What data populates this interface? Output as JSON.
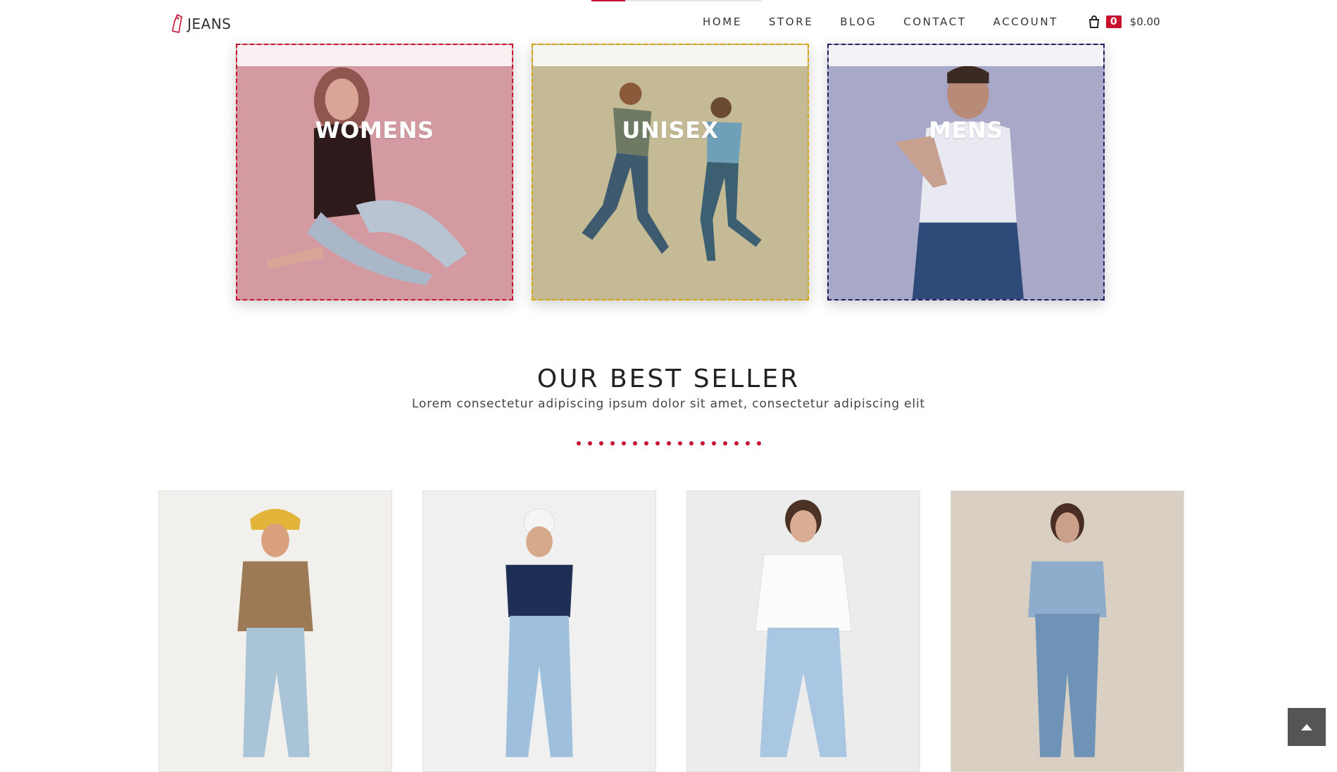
{
  "brand": {
    "name": "JEANS",
    "accent": "#c8102e"
  },
  "nav": {
    "items": [
      {
        "label": "HOME"
      },
      {
        "label": "STORE"
      },
      {
        "label": "BLOG"
      },
      {
        "label": "CONTACT"
      },
      {
        "label": "ACCOUNT"
      }
    ],
    "cart": {
      "icon": "shopping-bag-icon",
      "count": "0",
      "total": "$0.00"
    }
  },
  "categories": [
    {
      "label": "WOMENS",
      "overlay": "#d49aa1",
      "border": "#c8102e"
    },
    {
      "label": "UNISEX",
      "overlay": "#c4ba96",
      "border": "#d6a400"
    },
    {
      "label": "MENS",
      "overlay": "#a8a8c8",
      "border": "#1f1f5e"
    }
  ],
  "best_seller": {
    "title": "OUR BEST SELLER",
    "subtitle": "Lorem consectetur adipiscing ipsum dolor sit amet, consectetur adipiscing elit"
  },
  "back_to_top": {
    "icon": "chevron-up-icon"
  }
}
